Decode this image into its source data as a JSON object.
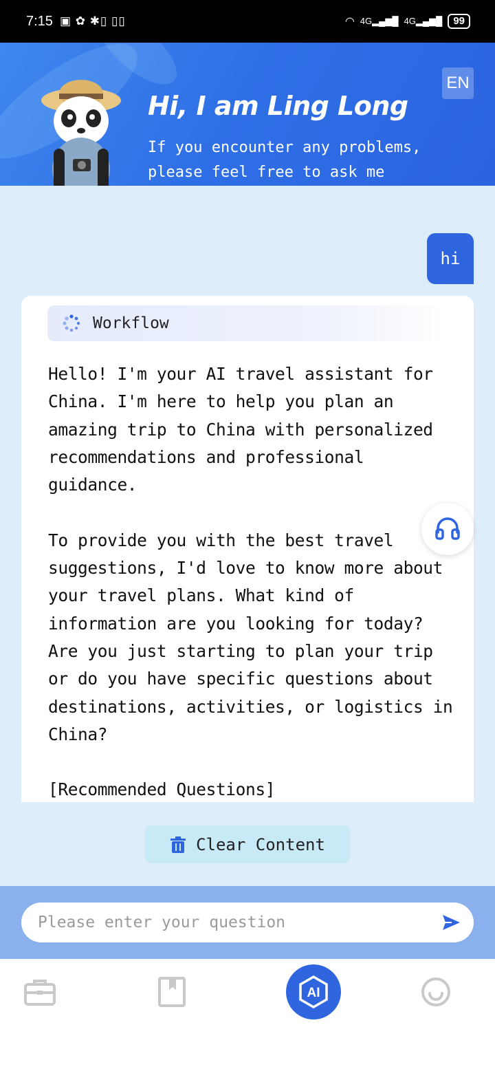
{
  "status_bar": {
    "time": "7:15",
    "battery": "99"
  },
  "header": {
    "greeting": "Hi,   I am Ling Long",
    "subtitle": "If you encounter any problems, please feel free to ask me",
    "language_button": "EN"
  },
  "chat": {
    "user_message": "hi",
    "workflow_label": "Workflow",
    "assistant_reply": "Hello! I'm your AI travel assistant for China. I'm here to help you plan an amazing trip to China with personalized recommendations and professional guidance.\n\nTo provide you with the best travel suggestions, I'd love to know more about your travel plans. What kind of information are you looking for today? Are you just starting to plan your trip or do you have specific questions about destinations, activities, or logistics in China?\n\n[Recommended Questions]"
  },
  "actions": {
    "clear_label": "Clear Content"
  },
  "input": {
    "placeholder": "Please enter your question",
    "value": ""
  },
  "tab_bar": {
    "items": [
      "briefcase-icon",
      "bookmark-icon",
      "ai-icon",
      "smile-icon"
    ],
    "active": "ai-icon"
  },
  "colors": {
    "primary": "#2f66e0",
    "chat_background": "#ddeefa",
    "input_bar": "#8bb0ee"
  }
}
